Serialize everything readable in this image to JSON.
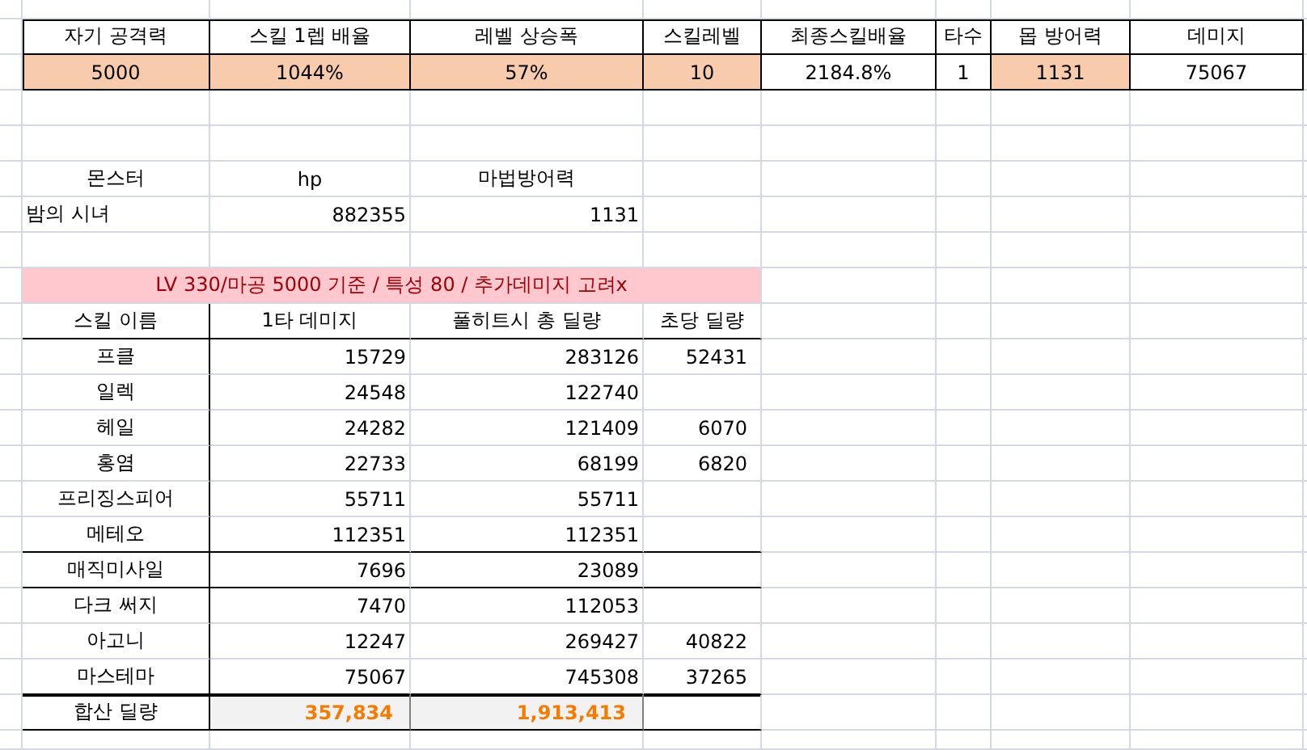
{
  "stats_table": {
    "headers": [
      "자기 공격력",
      "스킬 1렙 배율",
      "레벨 상승폭",
      "스킬레벨",
      "최종스킬배율",
      "타수",
      "몹 방어력",
      "데미지"
    ],
    "values": [
      {
        "text": "5000",
        "highlighted": true
      },
      {
        "text": "1044%",
        "highlighted": true
      },
      {
        "text": "57%",
        "highlighted": true
      },
      {
        "text": "10",
        "highlighted": true
      },
      {
        "text": "2184.8%",
        "highlighted": false
      },
      {
        "text": "1",
        "highlighted": false
      },
      {
        "text": "1131",
        "highlighted": true
      },
      {
        "text": "75067",
        "highlighted": false
      }
    ]
  },
  "monster_table": {
    "headers": [
      "몬스터",
      "hp",
      "마법방어력"
    ],
    "row": [
      "밤의 시녀",
      "882355",
      "1131"
    ]
  },
  "banner": "LV 330/마공 5000 기준 / 특성 80 / 추가데미지 고려x",
  "skill_table": {
    "headers": [
      "스킬 이름",
      "1타 데미지",
      "풀히트시 총 딜량",
      "초당 딜량"
    ],
    "rows": [
      {
        "name": "프클",
        "first_hit": "15729",
        "full_hit": "283126",
        "per_second": "52431",
        "line_below": false
      },
      {
        "name": "일렉",
        "first_hit": "24548",
        "full_hit": "122740",
        "line_below": false
      },
      {
        "name": "헤일",
        "first_hit": "24282",
        "full_hit": "121409",
        "per_second": "6070",
        "line_below": false
      },
      {
        "name": "홍염",
        "first_hit": "22733",
        "full_hit": "68199",
        "per_second": "6820",
        "line_below": false
      },
      {
        "name": "프리징스피어",
        "first_hit": "55711",
        "full_hit": "55711",
        "line_below": false
      },
      {
        "name": "메테오",
        "first_hit": "112351",
        "full_hit": "112351",
        "line_below": true
      },
      {
        "name": "매직미사일",
        "first_hit": "7696",
        "full_hit": "23089",
        "line_below": true
      },
      {
        "name": "다크 써지",
        "first_hit": "7470",
        "full_hit": "112053",
        "line_below": false
      },
      {
        "name": "아고니",
        "first_hit": "12247",
        "full_hit": "269427",
        "per_second": "40822",
        "line_below": false
      },
      {
        "name": "마스테마",
        "first_hit": "75067",
        "full_hit": "745308",
        "per_second": "37265",
        "line_below": true
      }
    ],
    "total": {
      "label": "합산 딜량",
      "first_hit": "357,834",
      "full_hit": "1,913,413"
    }
  }
}
